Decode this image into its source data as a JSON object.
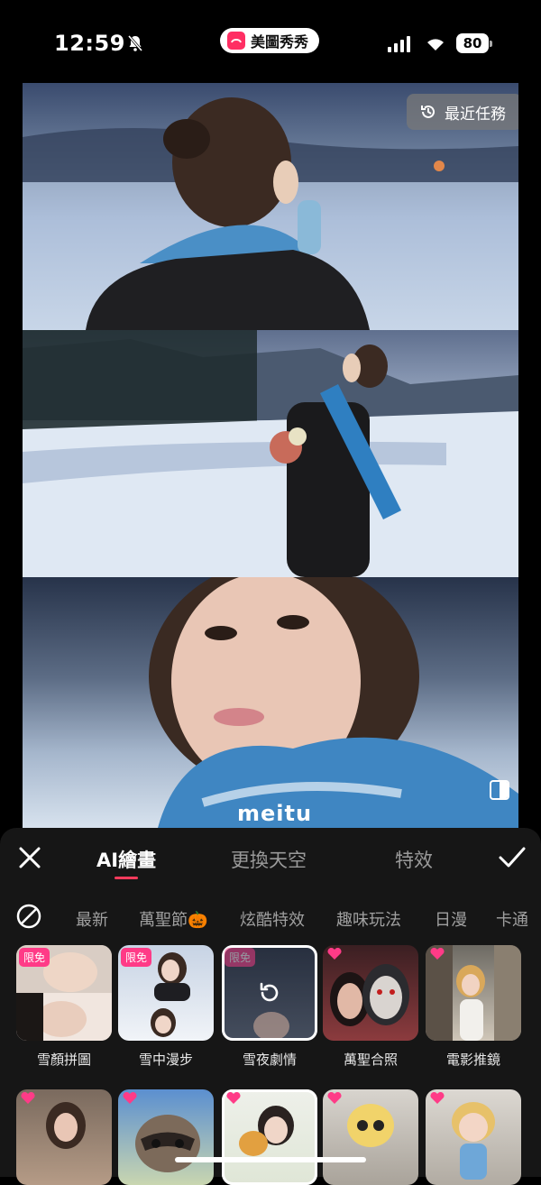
{
  "status_bar": {
    "time": "12:59",
    "app_name": "美圖秀秀",
    "battery": "80"
  },
  "preview": {
    "recent_tasks_label": "最近任務",
    "watermark": "meitu"
  },
  "top_tabs": [
    {
      "label": "AI繪畫",
      "active": true
    },
    {
      "label": "更換天空",
      "active": false
    },
    {
      "label": "特效",
      "active": false
    }
  ],
  "categories": [
    "最新",
    "萬聖節🎃",
    "炫酷特效",
    "趣味玩法",
    "日漫",
    "卡通"
  ],
  "effects_row1": [
    {
      "label": "雪顏拼圖",
      "badge": "限免"
    },
    {
      "label": "雪中漫步",
      "badge": "限免"
    },
    {
      "label": "雪夜劇情",
      "badge": "限免",
      "selected": true
    },
    {
      "label": "萬聖合照",
      "badge": ""
    },
    {
      "label": "電影推鏡",
      "badge": ""
    }
  ],
  "colors": {
    "accent": "#ff3b5c",
    "badge": "#ff3b87",
    "sheet": "#161616"
  }
}
